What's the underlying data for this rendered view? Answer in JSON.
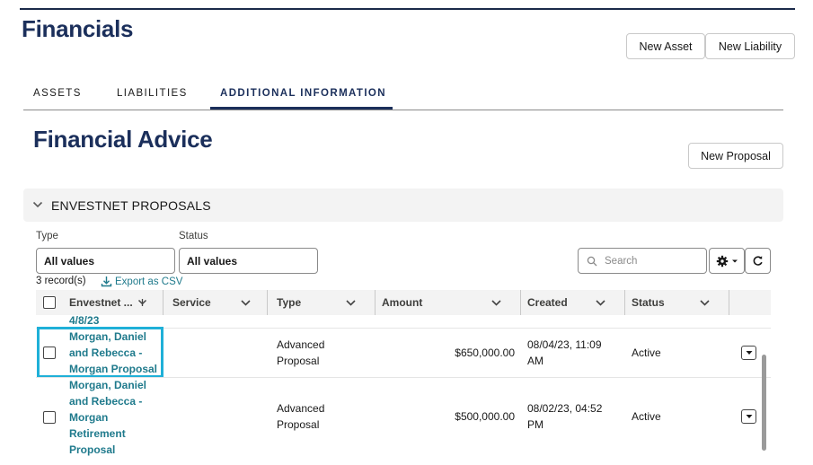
{
  "page": {
    "title": "Financials"
  },
  "header_buttons": {
    "new_asset": "New Asset",
    "new_liability": "New Liability"
  },
  "tabs": [
    {
      "label": "ASSETS",
      "active": false
    },
    {
      "label": "LIABILITIES",
      "active": false
    },
    {
      "label": "ADDITIONAL INFORMATION",
      "active": true
    }
  ],
  "section": {
    "title": "Financial Advice",
    "new_proposal": "New Proposal"
  },
  "accordion": {
    "title": "ENVESTNET PROPOSALS",
    "expanded": true
  },
  "filters": {
    "type": {
      "label": "Type",
      "value": "All values"
    },
    "status": {
      "label": "Status",
      "value": "All values"
    },
    "search_placeholder": "Search"
  },
  "records": {
    "count": "3 record(s)",
    "export": "Export as CSV"
  },
  "table": {
    "columns": [
      "Envestnet ...",
      "Service",
      "Type",
      "Amount",
      "Created",
      "Status"
    ],
    "rows": [
      {
        "name_partial": "4/8/23"
      },
      {
        "name_lines": [
          "Morgan, Daniel",
          "and Rebecca -",
          "Morgan Proposal"
        ],
        "service": "",
        "type_lines": [
          "Advanced",
          "Proposal"
        ],
        "amount": "$650,000.00",
        "created_lines": [
          "08/04/23, 11:09",
          "AM"
        ],
        "status": "Active"
      },
      {
        "name_lines": [
          "Morgan, Daniel",
          "and Rebecca -",
          "Morgan",
          "Retirement",
          "Proposal"
        ],
        "service": "",
        "type_lines": [
          "Advanced",
          "Proposal"
        ],
        "amount": "$500,000.00",
        "created_lines": [
          "08/02/23, 04:52",
          "PM"
        ],
        "status": "Active"
      }
    ]
  },
  "colors": {
    "brand_navy": "#1b2f5b",
    "link_teal": "#1f7a8c",
    "highlight": "#1fb0d8"
  }
}
